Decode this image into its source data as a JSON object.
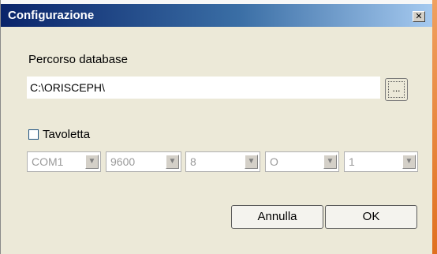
{
  "window": {
    "title": "Configurazione",
    "close_glyph": "✕"
  },
  "database": {
    "label": "Percorso database",
    "path_value": "C:\\ORISCEPH\\",
    "browse_label": "..."
  },
  "tavoletta": {
    "label": "Tavoletta",
    "checked": false,
    "combos": [
      {
        "name": "port",
        "value": "COM1"
      },
      {
        "name": "baud",
        "value": "9600"
      },
      {
        "name": "data-bits",
        "value": "8"
      },
      {
        "name": "parity",
        "value": "O"
      },
      {
        "name": "stop-bits",
        "value": "1"
      }
    ]
  },
  "buttons": {
    "cancel": "Annulla",
    "ok": "OK"
  }
}
